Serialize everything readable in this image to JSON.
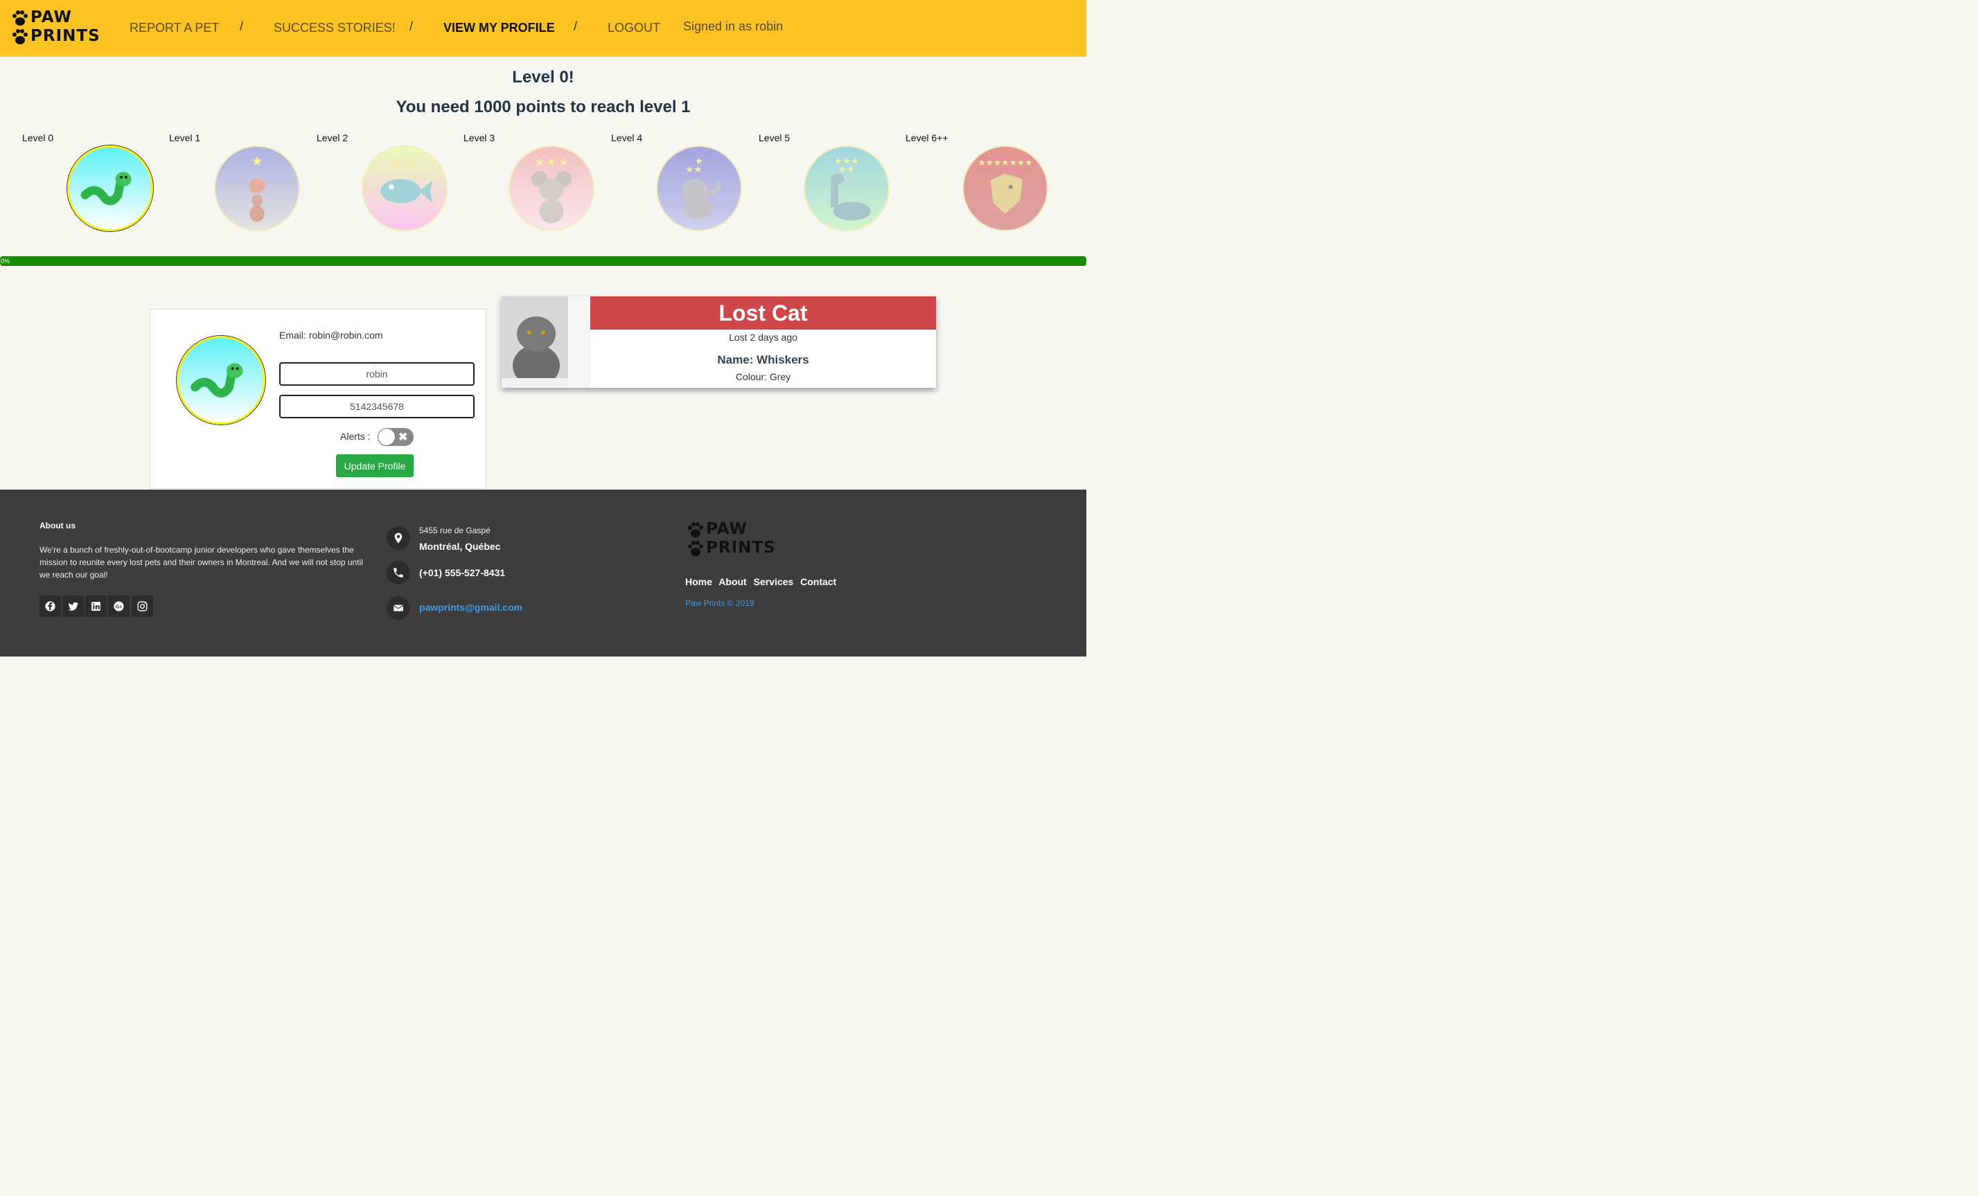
{
  "nav": {
    "logo_line1": "PAW",
    "logo_line2": "PRINTS",
    "report": "REPORT A PET",
    "stories": "SUCCESS STORIES!",
    "profile": "VIEW MY PROFILE",
    "logout": "LOGOUT",
    "separator": "/",
    "signed_in": "Signed in as robin"
  },
  "level": {
    "title": "Level 0!",
    "subtitle": "You need 1000 points to reach level 1",
    "badges": [
      "Level 0",
      "Level 1",
      "Level 2",
      "Level 3",
      "Level 4",
      "Level 5",
      "Level 6++"
    ],
    "badge_icons": [
      "worm-icon",
      "ant-icon",
      "fish-icon",
      "mouse-icon",
      "elephant-icon",
      "dinosaur-icon",
      "dragon-icon"
    ],
    "progress_label": "0%",
    "progress_value": 0
  },
  "profile": {
    "email": "Email: robin@robin.com",
    "username": "robin",
    "phone": "5142345678",
    "alerts_label": "Alerts :",
    "alerts_on": false,
    "update_button": "Update Profile"
  },
  "lost": {
    "status": "Lost Cat",
    "ago": "Lost 2 days ago",
    "name": "Name: Whiskers",
    "colour": "Colour: Grey"
  },
  "footer": {
    "about_title": "About us",
    "about_text": "We're a bunch of freshly-out-of-bootcamp junior developers who gave themselves the mission to reunite every lost pets and their owners in Montreal. And we will not stop until we reach our goal!",
    "address_line1": "5455 rue de Gaspé",
    "address_line2": "Montréal, Québec",
    "phone": "(+01) 555-527-8431",
    "email": "pawprints@gmail.com",
    "links": [
      "Home",
      "About",
      "Services",
      "Contact"
    ],
    "copyright": "Paw Prints © 2019"
  },
  "colors": {
    "header": "#fbc224",
    "progress": "#198a00",
    "lost_banner": "#d0474a",
    "button": "#28a745",
    "footer": "#3d3d3d",
    "link": "#3c9be8"
  }
}
